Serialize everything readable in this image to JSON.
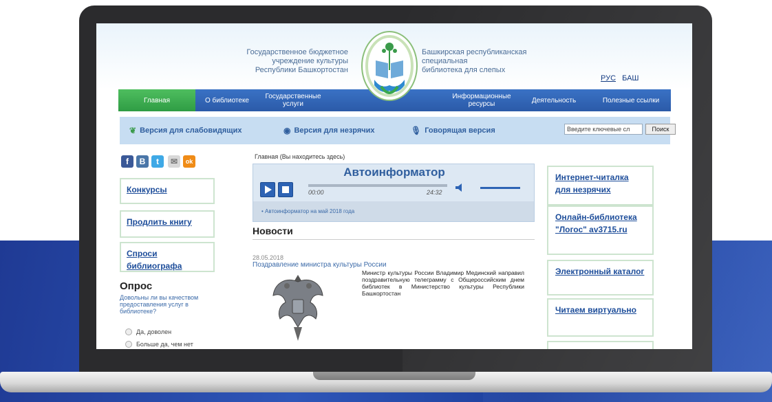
{
  "header": {
    "left_line1": "Государственное бюджетное",
    "left_line2": "учреждение культуры",
    "left_line3": "Республики Башкортостан",
    "right_line1": "Башкирская республиканская",
    "right_line2": "специальная",
    "right_line3": "библиотека для слепых",
    "lang_ru": "РУС",
    "lang_ba": "БАШ"
  },
  "nav": {
    "items": [
      {
        "label": "Главная"
      },
      {
        "label": "О библиотеке"
      },
      {
        "label": "Государственные услуги"
      },
      {
        "label": "Информационные ресурсы"
      },
      {
        "label": "Деятельность"
      },
      {
        "label": "Полезные ссылки"
      }
    ]
  },
  "accessibility": {
    "low_vision": "Версия для слабовидящих",
    "blind": "Версия для незрячих",
    "talking": "Говорящая версия",
    "search_placeholder": "Введите ключевые сл",
    "search_button": "Поиск"
  },
  "social": [
    "f",
    "В",
    "t",
    "✉",
    "ok"
  ],
  "left_boxes": [
    "Конкурсы",
    "Продлить книгу",
    "Спроси библиографа"
  ],
  "poll": {
    "title": "Опрос",
    "question": "Довольны ли вы качеством предоставления услуг в библиотеке?",
    "options": [
      "Да, доволен",
      "Больше да, чем нет"
    ]
  },
  "breadcrumb": "Главная (Вы находитесь здесь)",
  "player": {
    "title": "Автоинформатор",
    "current_time": "00:00",
    "total_time": "24:32",
    "progress": 0,
    "volume": 0.8,
    "playlist_item": "Автоинформатор на май 2018 года"
  },
  "news": {
    "heading": "Новости",
    "date": "28.05.2018",
    "title": "Поздравление министра культуры России",
    "body": "Министр культуры России Владимир Мединский направил поздравительную телеграмму с Общероссийским днем библиотек в Министерство культуры Республики Башкортостан"
  },
  "right_boxes": [
    "Интернет-читалка для незрячих",
    "Онлайн-библиотека \"Логос\" av3715.ru",
    "Электронный каталог",
    "Читаем виртуально"
  ],
  "colors": {
    "nav_blue": "#2f5fae",
    "nav_active_green": "#3aa84e",
    "link_blue": "#1d4d9a",
    "background_band": "#2546a6"
  }
}
